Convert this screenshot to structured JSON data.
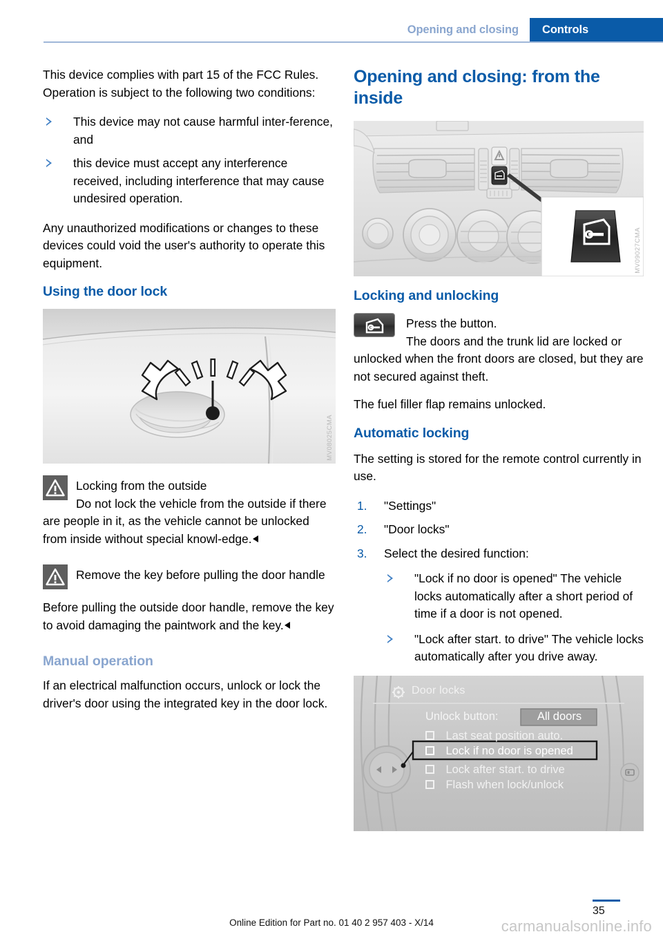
{
  "header": {
    "breadcrumb_section": "Opening and closing",
    "breadcrumb_chapter": "Controls",
    "accent_color": "#0a5ba8",
    "muted_accent_color": "#8aa6cf"
  },
  "left_column": {
    "fcc_paragraph": "This device complies with part 15 of the FCC Rules. Operation is subject to the following two conditions:",
    "fcc_bullets": [
      "This device may not cause harmful inter-ference, and",
      "this device must accept any interference received, including interference that may cause undesired operation."
    ],
    "unauthorized_paragraph": "Any unauthorized modifications or changes to these devices could void the user's authority to operate this equipment.",
    "door_lock_heading": "Using the door lock",
    "door_lock_figure_code": "MV08025CMA",
    "warning_1": {
      "icon": "warning-triangle-icon",
      "title": "Locking from the outside",
      "body": "Do not lock the vehicle from the outside if there are people in it, as the vehicle cannot be unlocked from inside without special knowl-edge."
    },
    "warning_2": {
      "icon": "warning-triangle-icon",
      "title": "Remove the key before pulling the door handle",
      "body": "Before pulling the outside door handle, remove the key to avoid damaging the paintwork and the key."
    },
    "manual_operation_heading": "Manual operation",
    "manual_operation_body": "If an electrical malfunction occurs, unlock or lock the driver's door using the integrated key in the door lock."
  },
  "right_column": {
    "chapter_title": "Opening and closing: from the inside",
    "dashboard_figure_code": "MV09027CMA",
    "locking_heading": "Locking and unlocking",
    "press_button_label": "Press the button.",
    "press_button_icon": "door-lock-button-icon",
    "locking_body": "The doors and the trunk lid are locked or unlocked when the front doors are closed, but they are not secured against theft.",
    "fuel_flap_body": "The fuel filler flap remains unlocked.",
    "automatic_heading": "Automatic locking",
    "automatic_intro": "The setting is stored for the remote control currently in use.",
    "steps": [
      {
        "number": "1.",
        "text": "\"Settings\""
      },
      {
        "number": "2.",
        "text": "\"Door locks\""
      },
      {
        "number": "3.",
        "text": "Select the desired function:"
      }
    ],
    "step3_bullets": [
      "\"Lock if no door is opened\" The vehicle locks automatically after a short period of time if a door is not opened.",
      "\"Lock after start. to drive\" The vehicle locks automatically after you drive away."
    ]
  },
  "idrive_screen": {
    "title": "Door locks",
    "title_icon": "settings-gear-icon",
    "unlock_label": "Unlock button:",
    "unlock_value": "All doors",
    "options": [
      {
        "label": "Last seat position auto.",
        "checked": false,
        "highlighted": false
      },
      {
        "label": "Lock if no door is opened",
        "checked": false,
        "highlighted": true
      },
      {
        "label": "Lock after start. to drive",
        "checked": false,
        "highlighted": false
      },
      {
        "label": "Flash when lock/unlock",
        "checked": false,
        "highlighted": false
      }
    ]
  },
  "footer": {
    "edition_text": "Online Edition for Part no. 01 40 2 957 403 - X/14",
    "watermark": "carmanualsonline.info",
    "page_number": "35"
  }
}
